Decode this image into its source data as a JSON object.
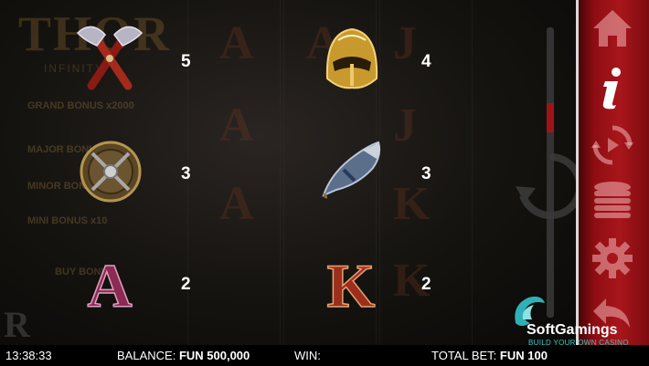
{
  "game": {
    "logo_text": "THOR",
    "logo_sub": "INFINITY",
    "bonus_labels": [
      "GRAND BONUS x2000",
      "MAJOR BONUS x50",
      "MINOR BONUS x25",
      "MINI BONUS x10",
      "BUY BONUS"
    ]
  },
  "paytable": [
    {
      "symbol": "crossed-axes-icon",
      "value": "5"
    },
    {
      "symbol": "golden-helmet-icon",
      "value": "4"
    },
    {
      "symbol": "round-shield-icon",
      "value": "3"
    },
    {
      "symbol": "drinking-horn-icon",
      "value": "3"
    },
    {
      "symbol": "letter-a-symbol",
      "value": "2",
      "glyph": "A"
    },
    {
      "symbol": "letter-k-symbol",
      "value": "2",
      "glyph": "K"
    }
  ],
  "scrollbar": {
    "position_fraction": 0.29
  },
  "sidebar": {
    "buttons": [
      "home-icon",
      "info-icon",
      "autoplay-icon",
      "coins-icon",
      "settings-icon",
      "back-icon"
    ],
    "active": "info-icon",
    "accent": "#a8161b"
  },
  "brand": {
    "name": "SoftGamings",
    "tagline": "BUILD YOUR OWN CASINO"
  },
  "status_bar": {
    "time": "13:38:33",
    "balance_label": "BALANCE:",
    "balance_value": "FUN 500,000",
    "win_label": "WIN:",
    "win_value": "",
    "total_bet_label": "TOTAL BET:",
    "total_bet_value": "FUN 100"
  }
}
